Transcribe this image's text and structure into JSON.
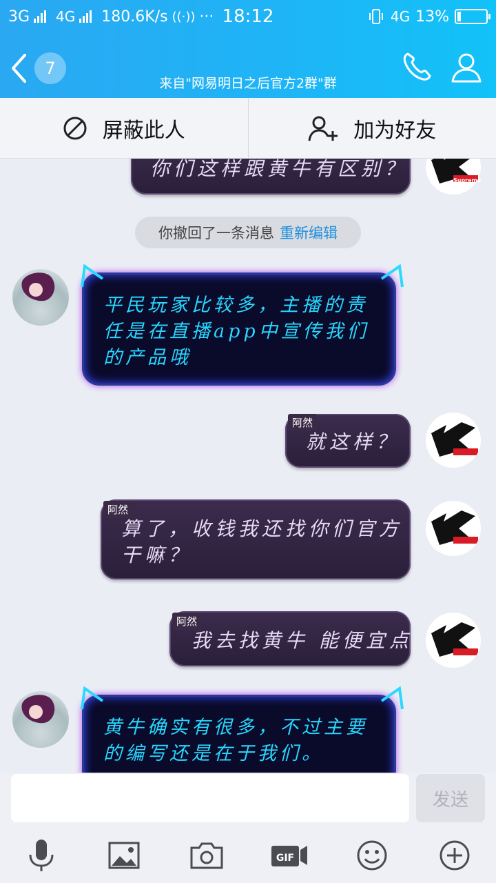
{
  "status_bar": {
    "net1": "3G",
    "net2": "4G",
    "speed": "180.6K/s",
    "dots": "···",
    "time": "18:12",
    "net3": "4G",
    "battery": "13%"
  },
  "header": {
    "unread_count": "7",
    "subtitle": "来自\"网易明日之后官方2群\"群"
  },
  "actions": {
    "block_label": "屏蔽此人",
    "add_friend_label": "加为好友"
  },
  "messages": {
    "m0_text": "你们这样跟黄牛有区别？",
    "recall_text": "你撤回了一条消息",
    "recall_link": "重新编辑",
    "m1_line1": "平民玩家比较多，主播的责",
    "m1_line2": "任是在直播app中宣传我们",
    "m1_line3": "的产品哦",
    "m2_tag": "阿然",
    "m2_text": "就这样？",
    "m3_tag": "阿然",
    "m3_line1": "算了，收钱我还找你们官方",
    "m3_line2": "干嘛？",
    "m4_tag": "阿然",
    "m4_text": "我去找黄牛 能便宜点",
    "m5_line1": "黄牛确实有很多，不过主要",
    "m5_line2": "的编写还是在于我们。",
    "supreme_label": "Supreme"
  },
  "input": {
    "send_label": "发送",
    "gif_label": "GIF"
  },
  "colors": {
    "header_blue": "#1fb4f6",
    "link_blue": "#1a8ee0",
    "neon_text": "#27d7ff",
    "bubble_text": "#e6d9f3"
  }
}
